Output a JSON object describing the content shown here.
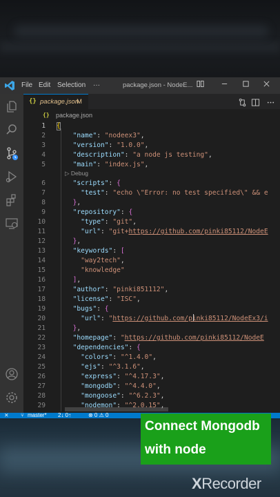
{
  "window": {
    "title": "package.json - NodeE...",
    "menu": [
      "File",
      "Edit",
      "Selection",
      "···"
    ]
  },
  "tab": {
    "icon_text": "{}",
    "label": "package.json",
    "modified_marker": "M"
  },
  "breadcrumb": {
    "icon_text": "{}",
    "label": "package.json"
  },
  "editor": {
    "codelens": "▷ Debug",
    "lines": [
      {
        "n": "1"
      },
      {
        "n": "2"
      },
      {
        "n": "3"
      },
      {
        "n": "4"
      },
      {
        "n": "5"
      },
      {
        "n": "6"
      },
      {
        "n": "7"
      },
      {
        "n": "8"
      },
      {
        "n": "9"
      },
      {
        "n": "10"
      },
      {
        "n": "11"
      },
      {
        "n": "12"
      },
      {
        "n": "13"
      },
      {
        "n": "14"
      },
      {
        "n": "15"
      },
      {
        "n": "16"
      },
      {
        "n": "17"
      },
      {
        "n": "18"
      },
      {
        "n": "19"
      },
      {
        "n": "20"
      },
      {
        "n": "21"
      },
      {
        "n": "22"
      },
      {
        "n": "23"
      },
      {
        "n": "24"
      },
      {
        "n": "25"
      },
      {
        "n": "26"
      },
      {
        "n": "27"
      },
      {
        "n": "28"
      },
      {
        "n": "29"
      }
    ],
    "code": {
      "l1": "{",
      "name_k": "\"name\"",
      "name_v": "\"nodeex3\"",
      "version_k": "\"version\"",
      "version_v": "\"1.0.0\"",
      "description_k": "\"description\"",
      "description_v": "\"a node js testing\"",
      "main_k": "\"main\"",
      "main_v": "\"index.js\"",
      "scripts_k": "\"scripts\"",
      "test_k": "\"test\"",
      "test_v": "\"echo \\\"Error: no test specified\\\" && e",
      "repository_k": "\"repository\"",
      "type_k": "\"type\"",
      "type_v": "\"git\"",
      "url_k": "\"url\"",
      "url_prefix": "\"git+",
      "url_link": "https://github.com/pinki85112/NodeE",
      "keywords_k": "\"keywords\"",
      "kw1": "\"way2tech\"",
      "kw2": "\"knowledge\"",
      "author_k": "\"author\"",
      "author_v": "\"pinki851112\"",
      "license_k": "\"license\"",
      "license_v": "\"ISC\"",
      "bugs_k": "\"bugs\"",
      "bugs_url_k": "\"url\"",
      "bugs_url_link": "https://github.com/pinki85112/NodeEx3/i",
      "homepage_k": "\"homepage\"",
      "homepage_link": "https://github.com/pinki85112/NodeE",
      "deps_k": "\"dependencies\"",
      "colors_k": "\"colors\"",
      "colors_v": "\"^1.4.0\"",
      "ejs_k": "\"ejs\"",
      "ejs_v": "\"^3.1.6\"",
      "express_k": "\"express\"",
      "express_v": "\"^4.17.3\"",
      "mongodb_k": "\"mongodb\"",
      "mongodb_v": "\"^4.4.0\"",
      "mongoose_k": "\"mongoose\"",
      "mongoose_v": "\"^6.2.3\"",
      "nodemon_k": "\"nodemon\"",
      "nodemon_v": "\"^2.0.15\""
    }
  },
  "statusbar": {
    "remote": "⨯",
    "branch": "master*",
    "sync": "2↓ 0↑",
    "problems": "⊗ 0 ⚠ 0"
  },
  "overlay": {
    "caption_line1": "Connect Mongodb",
    "caption_line2": "with node",
    "watermark_x": "X",
    "watermark_rest": "Recorder"
  },
  "colors": {
    "accent": "#007acc",
    "caption_bg": "#1aa01a",
    "json_key": "#9cdcfe",
    "json_string": "#ce9178"
  }
}
